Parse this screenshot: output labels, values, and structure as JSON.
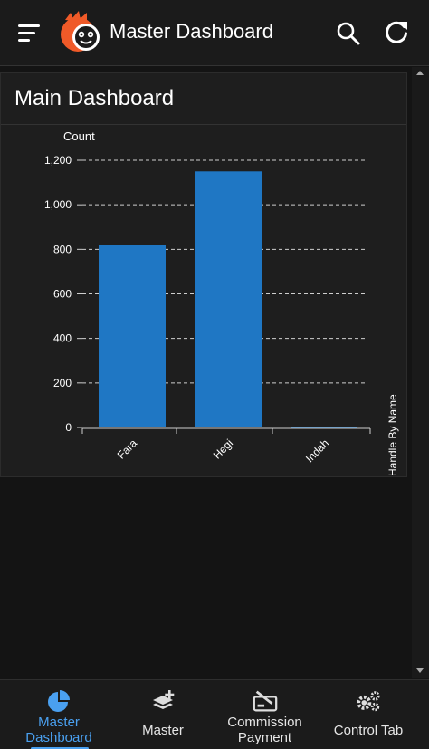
{
  "header": {
    "title": "Master Dashboard",
    "icons": [
      "menu-icon",
      "logo-icon",
      "search-icon",
      "refresh-icon"
    ]
  },
  "card": {
    "title": "Main Dashboard"
  },
  "chart_data": {
    "type": "bar",
    "categories": [
      "Fara",
      "Hegi",
      "Indah"
    ],
    "values": [
      820,
      1150,
      2
    ],
    "title": "",
    "xlabel": "Handle By Name",
    "ylabel": "Count",
    "ylim": [
      0,
      1200
    ],
    "yticks": [
      0,
      200,
      400,
      600,
      800,
      1000,
      1200
    ],
    "ytick_labels": [
      "0",
      "200",
      "400",
      "600",
      "800",
      "1,000",
      "1,200"
    ],
    "grid": true,
    "bar_color": "#1f77c4"
  },
  "nav": {
    "items": [
      {
        "label": "Master\nDashboard",
        "icon": "pie-chart-icon",
        "active": true
      },
      {
        "label": "Master",
        "icon": "layers-add-icon",
        "active": false
      },
      {
        "label": "Commission\nPayment",
        "icon": "payment-icon",
        "active": false
      },
      {
        "label": "Control Tab",
        "icon": "gears-icon",
        "active": false
      }
    ]
  },
  "colors": {
    "accent": "#4aa0f0",
    "logo_orange": "#f05a28",
    "background": "#141414"
  }
}
